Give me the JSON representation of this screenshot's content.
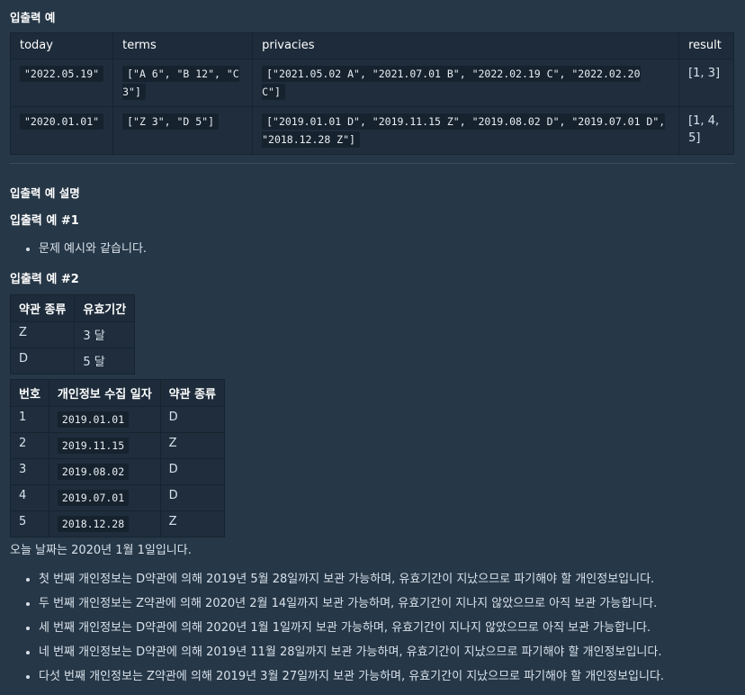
{
  "section_title": "입출력 예",
  "examples": {
    "headers": [
      "today",
      "terms",
      "privacies",
      "result"
    ],
    "rows": [
      {
        "today": "\"2022.05.19\"",
        "terms": "[\"A 6\", \"B 12\", \"C 3\"]",
        "privacies": "[\"2021.05.02 A\", \"2021.07.01 B\", \"2022.02.19 C\", \"2022.02.20 C\"]",
        "result": "[1, 3]"
      },
      {
        "today": "\"2020.01.01\"",
        "terms": "[\"Z 3\", \"D 5\"]",
        "privacies": "[\"2019.01.01 D\", \"2019.11.15 Z\", \"2019.08.02 D\", \"2019.07.01 D\", \"2018.12.28 Z\"]",
        "result": "[1, 4, 5]"
      }
    ]
  },
  "desc_title": "입출력 예 설명",
  "example1": {
    "title": "입출력 예 #1",
    "bullets": [
      "문제 예시와 같습니다."
    ]
  },
  "example2": {
    "title": "입출력 예 #2",
    "terms_headers": [
      "약관 종류",
      "유효기간"
    ],
    "terms_rows": [
      [
        "Z",
        "3 달"
      ],
      [
        "D",
        "5 달"
      ]
    ],
    "priv_headers": [
      "번호",
      "개인정보 수집 일자",
      "약관 종류"
    ],
    "priv_rows": [
      [
        "1",
        "2019.01.01",
        "D"
      ],
      [
        "2",
        "2019.11.15",
        "Z"
      ],
      [
        "3",
        "2019.08.02",
        "D"
      ],
      [
        "4",
        "2019.07.01",
        "D"
      ],
      [
        "5",
        "2018.12.28",
        "Z"
      ]
    ],
    "today_text": "오늘 날짜는 2020년 1월 1일입니다.",
    "bullets": [
      "첫 번째 개인정보는 D약관에 의해 2019년 5월 28일까지 보관 가능하며, 유효기간이 지났으므로 파기해야 할 개인정보입니다.",
      "두 번째 개인정보는 Z약관에 의해 2020년 2월 14일까지 보관 가능하며, 유효기간이 지나지 않았으므로 아직 보관 가능합니다.",
      "세 번째 개인정보는 D약관에 의해 2020년 1월 1일까지 보관 가능하며, 유효기간이 지나지 않았으므로 아직 보관 가능합니다.",
      "네 번째 개인정보는 D약관에 의해 2019년 11월 28일까지 보관 가능하며, 유효기간이 지났으므로 파기해야 할 개인정보입니다.",
      "다섯 번째 개인정보는 Z약관에 의해 2019년 3월 27일까지 보관 가능하며, 유효기간이 지났으므로 파기해야 할 개인정보입니다."
    ]
  }
}
